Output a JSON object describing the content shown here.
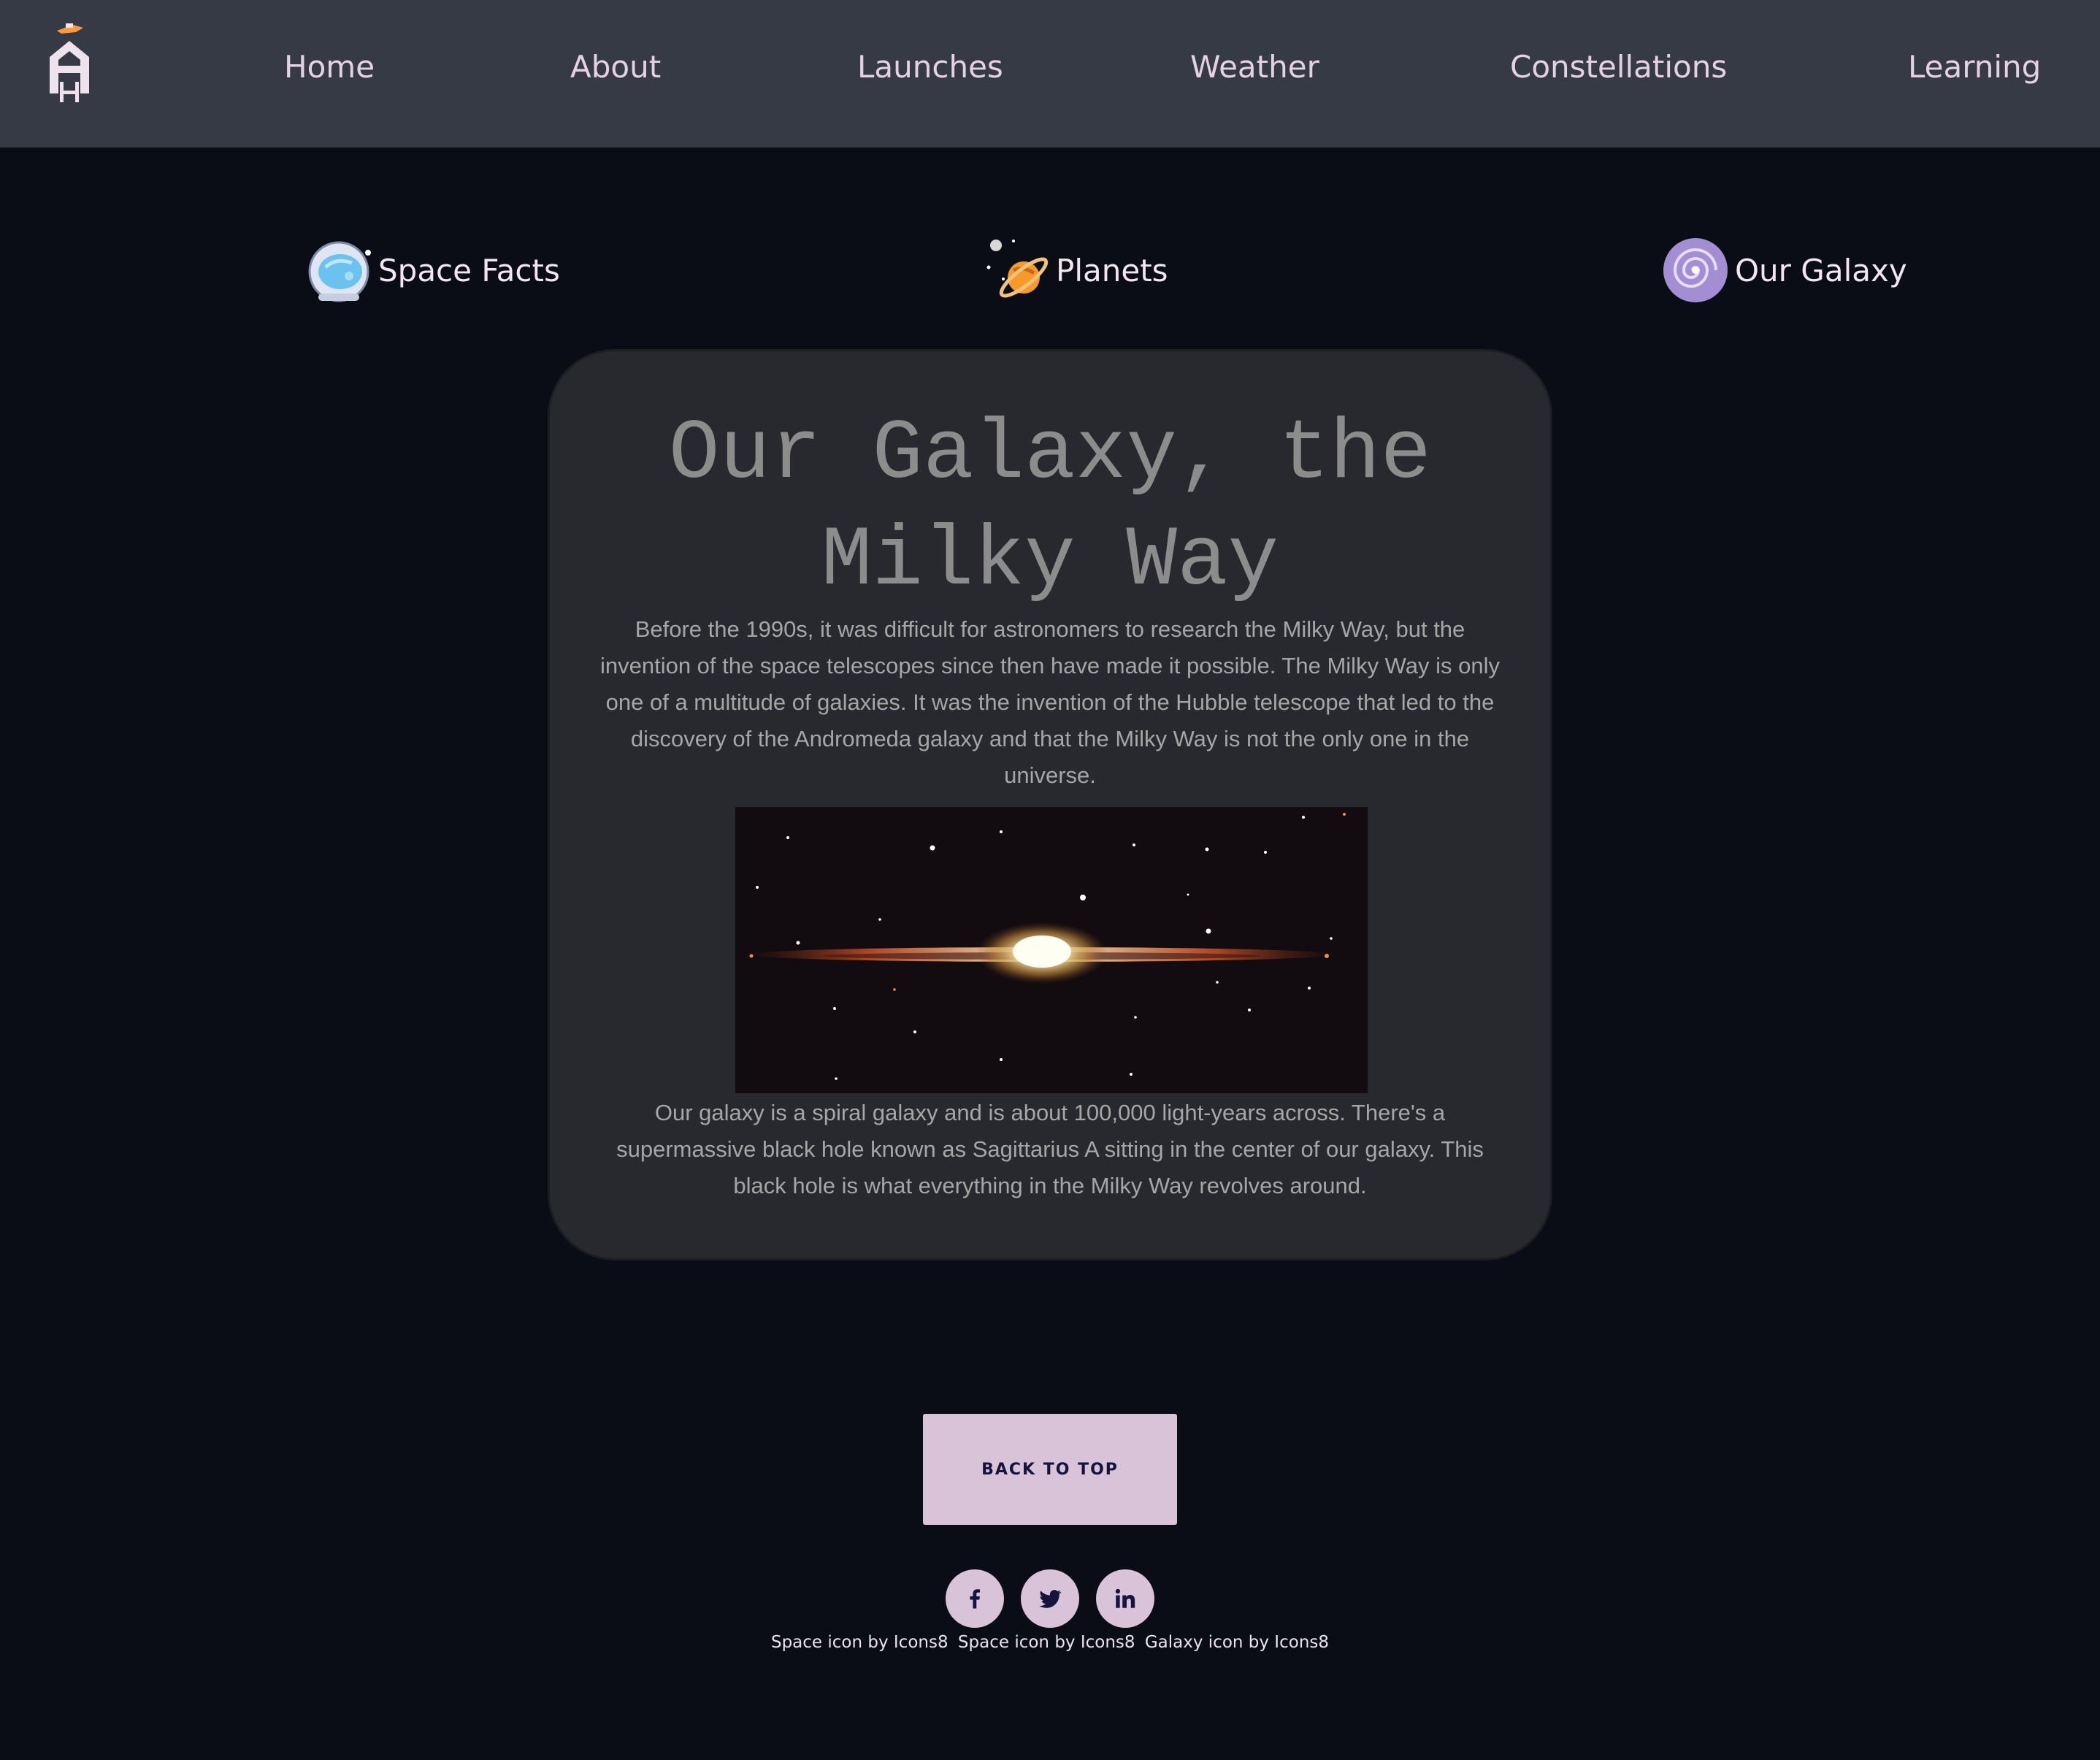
{
  "nav": {
    "logo_icon": "home-rocket-logo-icon",
    "links": [
      "Home",
      "About",
      "Launches",
      "Weather",
      "Constellations",
      "Learning"
    ]
  },
  "categories": [
    {
      "label": "Space Facts",
      "icon": "astronaut-helmet-icon"
    },
    {
      "label": "Planets",
      "icon": "planet-icon"
    },
    {
      "label": "Our Galaxy",
      "icon": "galaxy-icon"
    }
  ],
  "card": {
    "title": "Our Galaxy, the Milky Way",
    "paragraph1": "Before the 1990s, it was difficult for astronomers to research the Milky Way, but the invention of the space telescopes since then have made it possible. The Milky Way is only one of a multitude of galaxies. It was the invention of the Hubble telescope that led to the discovery of the Andromeda galaxy and that the Milky Way is not the only one in the universe.",
    "image": "milky-way-edge-on-image",
    "paragraph2": "Our galaxy is a spiral galaxy and is about 100,000 light-years across. There's a supermassive black hole known as Sagittarius A sitting in the center of our galaxy. This black hole is what everything in the Milky Way revolves around."
  },
  "footer": {
    "back_to_top": "BACK TO TOP",
    "social_icons": [
      "facebook-icon",
      "twitter-icon",
      "linkedin-icon"
    ],
    "credits": [
      "Space icon by Icons8",
      "Space icon by Icons8",
      "Galaxy icon by Icons8"
    ]
  },
  "colors": {
    "background": "#0a0d16",
    "navbar": "#363a45",
    "card": "#28292e",
    "accent": "#d9c3d8",
    "button_text": "#14143c"
  }
}
